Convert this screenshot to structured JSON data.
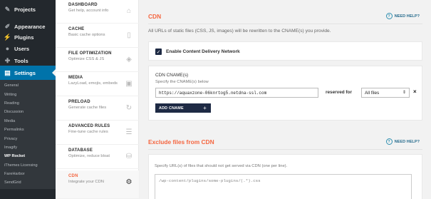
{
  "wp_menu": [
    {
      "label": "Projects",
      "icon": "pin-icon"
    },
    {
      "label": "Appearance",
      "icon": "brush-icon"
    },
    {
      "label": "Plugins",
      "icon": "plug-icon"
    },
    {
      "label": "Users",
      "icon": "user-icon"
    },
    {
      "label": "Tools",
      "icon": "wrench-icon"
    },
    {
      "label": "Settings",
      "icon": "settings-icon"
    }
  ],
  "wp_submenu": [
    "General",
    "Writing",
    "Reading",
    "Discussion",
    "Media",
    "Permalinks",
    "Privacy",
    "Imagify",
    "WP Rocket",
    "iThemes Licensing",
    "FareHarbor",
    "SendGrid"
  ],
  "rocket_nav": [
    {
      "title": "DASHBOARD",
      "subtitle": "Get help, account info",
      "icon": "home-icon"
    },
    {
      "title": "CACHE",
      "subtitle": "Basic cache options",
      "icon": "document-icon"
    },
    {
      "title": "FILE OPTIMIZATION",
      "subtitle": "Optimize CSS & JS",
      "icon": "layers-icon"
    },
    {
      "title": "MEDIA",
      "subtitle": "LazyLoad, emojis, embeds",
      "icon": "image-icon"
    },
    {
      "title": "PRELOAD",
      "subtitle": "Generate cache files",
      "icon": "refresh-icon"
    },
    {
      "title": "ADVANCED RULES",
      "subtitle": "Fine-tune cache rules",
      "icon": "list-icon"
    },
    {
      "title": "DATABASE",
      "subtitle": "Optimize, reduce bloat",
      "icon": "database-icon"
    },
    {
      "title": "CDN",
      "subtitle": "Integrate your CDN",
      "icon": "cdn-icon"
    }
  ],
  "cdn": {
    "title": "CDN",
    "help_label": "NEED HELP?",
    "description": "All URLs of static files (CSS, JS, images) will be rewritten to the CNAME(s) you provide.",
    "enable_label": "Enable Content Delivery Network",
    "enable_checked": true,
    "cname_title": "CDN CNAME(s)",
    "cname_sub": "Specify the CNAME(s) below",
    "cname_value": "https://aquaxzone-06knrtog5.netdna-ssl.com",
    "reserved_label": "reserved for",
    "reserved_value": "All files",
    "remove_label": "×",
    "add_label": "ADD CNAME",
    "add_plus": "+"
  },
  "exclude": {
    "title": "Exclude files from CDN",
    "help_label": "NEED HELP?",
    "description": "Specify URL(s) of files that should not get served via CDN (one per line).",
    "placeholder": "/wp-content/plugins/some-plugins/(.*).css"
  },
  "colors": {
    "accent": "#f56640",
    "wp_active": "#0073aa",
    "button": "#1e2a44",
    "help": "#2a6e8f"
  }
}
